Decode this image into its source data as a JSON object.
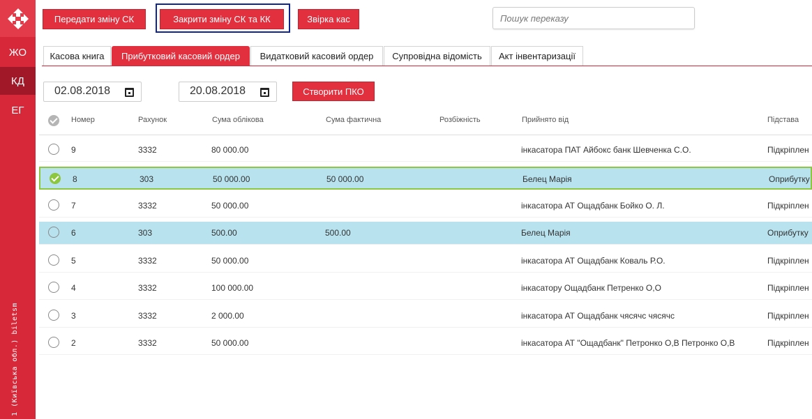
{
  "sidebar": {
    "nav": [
      {
        "label": "ЖО",
        "active": false
      },
      {
        "label": "КД",
        "active": true
      },
      {
        "label": "ЕГ",
        "active": false
      }
    ],
    "vertical_text": "1 (Київська обл.) biletsm"
  },
  "toolbar": {
    "transfer_shift": "Передати зміну СК",
    "close_shift": "Закрити зміну СК та КК",
    "reconcile": "Звірка кас"
  },
  "search": {
    "placeholder": "Пошук переказу"
  },
  "tabs": [
    {
      "label": "Касова книга",
      "active": false
    },
    {
      "label": "Прибутковий касовий ордер",
      "active": true
    },
    {
      "label": "Видатковий касовий ордер",
      "active": false
    },
    {
      "label": "Супровідна відомість",
      "active": false
    },
    {
      "label": "Акт інвентаризації",
      "active": false
    }
  ],
  "filters": {
    "date_from": "02.08.2018",
    "date_to": "20.08.2018",
    "create_button": "Створити ПКО"
  },
  "table": {
    "headers": {
      "number": "Номер",
      "account": "Рахунок",
      "amount_accounted": "Сума облікова",
      "amount_actual": "Сума фактична",
      "discrepancy": "Розбіжність",
      "received_from": "Прийнято від",
      "basis": "Підстава"
    },
    "rows": [
      {
        "number": "9",
        "account": "3332",
        "amount_accounted": "80 000.00",
        "amount_actual": "",
        "discrepancy": "",
        "received_from": "інкасатора ПАТ Айбокс банк Шевченка С.О.",
        "basis": "Підкріплен",
        "state": "none"
      },
      {
        "number": "8",
        "account": "303",
        "amount_accounted": "50 000.00",
        "amount_actual": "50 000.00",
        "discrepancy": "",
        "received_from": "Белец Марія",
        "basis": "Оприбутку",
        "state": "checked"
      },
      {
        "number": "7",
        "account": "3332",
        "amount_accounted": "50 000.00",
        "amount_actual": "",
        "discrepancy": "",
        "received_from": "інкасатора АТ Ощадбанк Бойко О. Л.",
        "basis": "Підкріплен",
        "state": "none"
      },
      {
        "number": "6",
        "account": "303",
        "amount_accounted": "500.00",
        "amount_actual": "500.00",
        "discrepancy": "",
        "received_from": "Белец Марія",
        "basis": "Оприбутку",
        "state": "highlight"
      },
      {
        "number": "5",
        "account": "3332",
        "amount_accounted": "50 000.00",
        "amount_actual": "",
        "discrepancy": "",
        "received_from": "інкасатора АТ Ощадбанк Коваль Р.О.",
        "basis": "Підкріплен",
        "state": "none"
      },
      {
        "number": "4",
        "account": "3332",
        "amount_accounted": "100 000.00",
        "amount_actual": "",
        "discrepancy": "",
        "received_from": "інкасатору Ощадбанк Петренко О,О",
        "basis": "Підкріплен",
        "state": "none"
      },
      {
        "number": "3",
        "account": "3332",
        "amount_accounted": "2 000.00",
        "amount_actual": "",
        "discrepancy": "",
        "received_from": "інкасатора АТ Ощадбанк чясячс чясячс",
        "basis": "Підкріплен",
        "state": "none"
      },
      {
        "number": "2",
        "account": "3332",
        "amount_accounted": "50 000.00",
        "amount_actual": "",
        "discrepancy": "",
        "received_from": "інкасатора АТ \"Ощадбанк\" Петронко О,В Петронко О,В",
        "basis": "Підкріплен",
        "state": "none"
      }
    ]
  },
  "colors": {
    "brand": "#e2303f",
    "sidebar": "#d7283a",
    "selected_row": "#b7e2ee",
    "check_green": "#8dc63f",
    "focus_outline": "#102590"
  }
}
